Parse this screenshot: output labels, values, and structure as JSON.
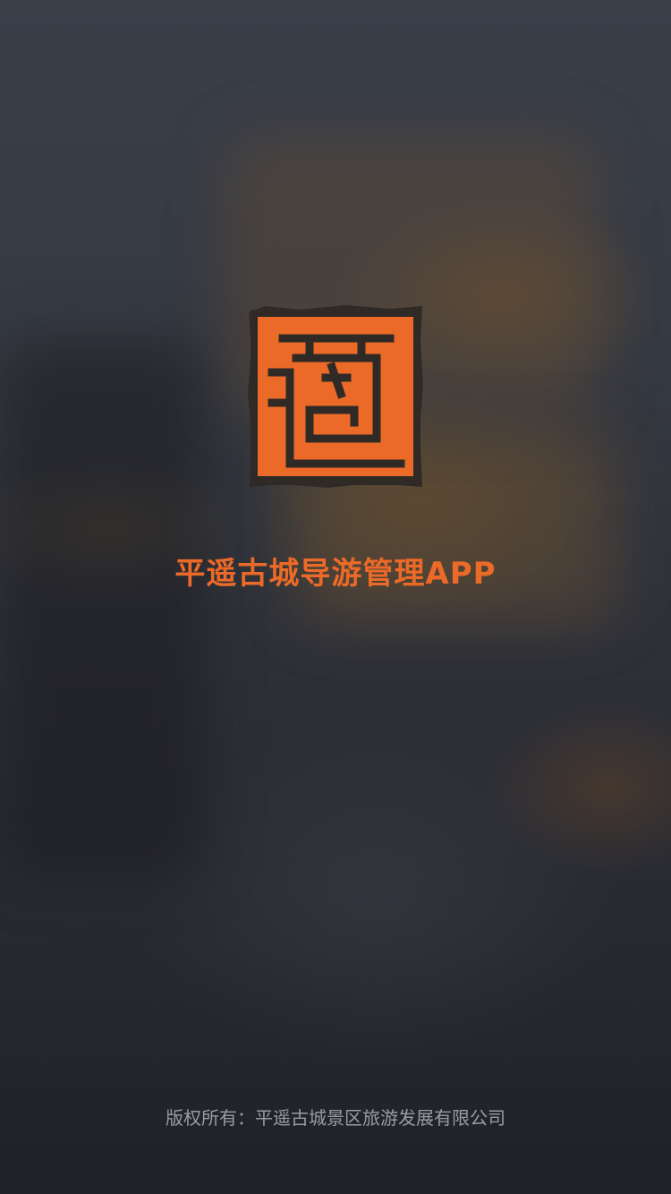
{
  "splash": {
    "logo_icon": "seal-logo-icon",
    "title": "平遥古城导游管理APP",
    "copyright": "版权所有：平遥古城景区旅游发展有限公司"
  },
  "colors": {
    "accent": "#ec6a28",
    "seal_ink": "#2f2a26",
    "background": "#2b2f38",
    "copyright_text": "#9a9ca3"
  }
}
